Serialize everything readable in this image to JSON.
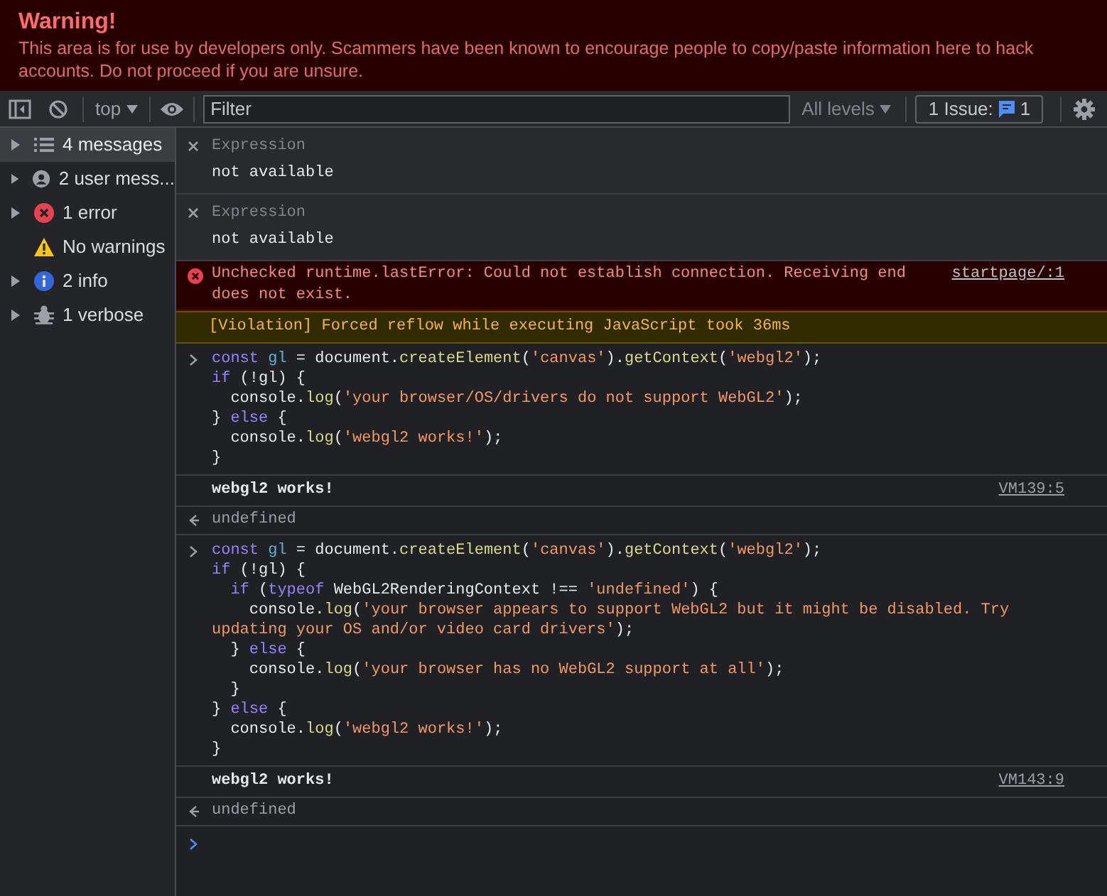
{
  "warning_banner": {
    "title": "Warning!",
    "text": "This area is for use by developers only. Scammers have been known to encourage people to copy/paste information here to hack accounts. Do not proceed if you are unsure."
  },
  "toolbar": {
    "context": "top",
    "filter": {
      "placeholder": "Filter"
    },
    "levels": "All levels",
    "issues_label": "1 Issue:",
    "issues_count": "1"
  },
  "sidebar": {
    "items": [
      {
        "label": "4 messages",
        "kind": "list",
        "expandable": true,
        "selected": true
      },
      {
        "label": "2 user mess...",
        "kind": "user",
        "expandable": true,
        "selected": false
      },
      {
        "label": "1 error",
        "kind": "error",
        "expandable": true,
        "selected": false
      },
      {
        "label": "No warnings",
        "kind": "warning",
        "expandable": false,
        "selected": false
      },
      {
        "label": "2 info",
        "kind": "info",
        "expandable": true,
        "selected": false
      },
      {
        "label": "1 verbose",
        "kind": "verbose",
        "expandable": true,
        "selected": false
      }
    ]
  },
  "console": [
    {
      "kind": "expression",
      "label": "Expression",
      "value": "not available"
    },
    {
      "kind": "expression",
      "label": "Expression",
      "value": "not available"
    },
    {
      "kind": "error",
      "text": "Unchecked runtime.lastError: Could not establish connection. Receiving end does not exist.",
      "source": "startpage/:1"
    },
    {
      "kind": "violation",
      "text": "[Violation] Forced reflow while executing JavaScript took 36ms"
    },
    {
      "kind": "input",
      "lines": [
        [
          {
            "kind": "keyword",
            "text": "const "
          },
          {
            "kind": "variable",
            "text": "gl"
          },
          {
            "kind": "plain",
            "text": " = document."
          },
          {
            "kind": "function",
            "text": "createElement"
          },
          {
            "kind": "plain",
            "text": "("
          },
          {
            "kind": "string",
            "text": "'canvas'"
          },
          {
            "kind": "plain",
            "text": ")."
          },
          {
            "kind": "function",
            "text": "getContext"
          },
          {
            "kind": "plain",
            "text": "("
          },
          {
            "kind": "string",
            "text": "'webgl2'"
          },
          {
            "kind": "plain",
            "text": ");"
          }
        ],
        [
          {
            "kind": "keyword",
            "text": "if"
          },
          {
            "kind": "plain",
            "text": " (!gl) {"
          }
        ],
        [
          {
            "kind": "plain",
            "text": "  console."
          },
          {
            "kind": "function",
            "text": "log"
          },
          {
            "kind": "plain",
            "text": "("
          },
          {
            "kind": "string",
            "text": "'your browser/OS/drivers do not support WebGL2'"
          },
          {
            "kind": "plain",
            "text": ");"
          }
        ],
        [
          {
            "kind": "plain",
            "text": "} "
          },
          {
            "kind": "keyword",
            "text": "else"
          },
          {
            "kind": "plain",
            "text": " {"
          }
        ],
        [
          {
            "kind": "plain",
            "text": "  console."
          },
          {
            "kind": "function",
            "text": "log"
          },
          {
            "kind": "plain",
            "text": "("
          },
          {
            "kind": "string",
            "text": "'webgl2 works!'"
          },
          {
            "kind": "plain",
            "text": ");"
          }
        ],
        [
          {
            "kind": "plain",
            "text": "}"
          }
        ]
      ]
    },
    {
      "kind": "log",
      "text": "webgl2 works!",
      "source": "VM139:5"
    },
    {
      "kind": "result",
      "text": "undefined"
    },
    {
      "kind": "input",
      "lines": [
        [
          {
            "kind": "keyword",
            "text": "const "
          },
          {
            "kind": "variable",
            "text": "gl"
          },
          {
            "kind": "plain",
            "text": " = document."
          },
          {
            "kind": "function",
            "text": "createElement"
          },
          {
            "kind": "plain",
            "text": "("
          },
          {
            "kind": "string",
            "text": "'canvas'"
          },
          {
            "kind": "plain",
            "text": ")."
          },
          {
            "kind": "function",
            "text": "getContext"
          },
          {
            "kind": "plain",
            "text": "("
          },
          {
            "kind": "string",
            "text": "'webgl2'"
          },
          {
            "kind": "plain",
            "text": ");"
          }
        ],
        [
          {
            "kind": "keyword",
            "text": "if"
          },
          {
            "kind": "plain",
            "text": " (!gl) {"
          }
        ],
        [
          {
            "kind": "keyword",
            "text": "  if"
          },
          {
            "kind": "plain",
            "text": " ("
          },
          {
            "kind": "keyword",
            "text": "typeof"
          },
          {
            "kind": "plain",
            "text": " WebGL2RenderingContext !== "
          },
          {
            "kind": "string",
            "text": "'undefined'"
          },
          {
            "kind": "plain",
            "text": ") {"
          }
        ],
        [
          {
            "kind": "plain",
            "text": "    console."
          },
          {
            "kind": "function",
            "text": "log"
          },
          {
            "kind": "plain",
            "text": "("
          },
          {
            "kind": "string",
            "text": "'your browser appears to support WebGL2 but it might be disabled. Try"
          }
        ],
        [
          {
            "kind": "string",
            "text": "updating your OS and/or video card drivers'"
          },
          {
            "kind": "plain",
            "text": ");"
          }
        ],
        [
          {
            "kind": "plain",
            "text": "  } "
          },
          {
            "kind": "keyword",
            "text": "else"
          },
          {
            "kind": "plain",
            "text": " {"
          }
        ],
        [
          {
            "kind": "plain",
            "text": "    console."
          },
          {
            "kind": "function",
            "text": "log"
          },
          {
            "kind": "plain",
            "text": "("
          },
          {
            "kind": "string",
            "text": "'your browser has no WebGL2 support at all'"
          },
          {
            "kind": "plain",
            "text": ");"
          }
        ],
        [
          {
            "kind": "plain",
            "text": "  }"
          }
        ],
        [
          {
            "kind": "plain",
            "text": "} "
          },
          {
            "kind": "keyword",
            "text": "else"
          },
          {
            "kind": "plain",
            "text": " {"
          }
        ],
        [
          {
            "kind": "plain",
            "text": "  console."
          },
          {
            "kind": "function",
            "text": "log"
          },
          {
            "kind": "plain",
            "text": "("
          },
          {
            "kind": "string",
            "text": "'webgl2 works!'"
          },
          {
            "kind": "plain",
            "text": ");"
          }
        ],
        [
          {
            "kind": "plain",
            "text": "}"
          }
        ]
      ]
    },
    {
      "kind": "log",
      "text": "webgl2 works!",
      "source": "VM143:9"
    },
    {
      "kind": "result",
      "text": "undefined"
    },
    {
      "kind": "prompt"
    }
  ]
}
